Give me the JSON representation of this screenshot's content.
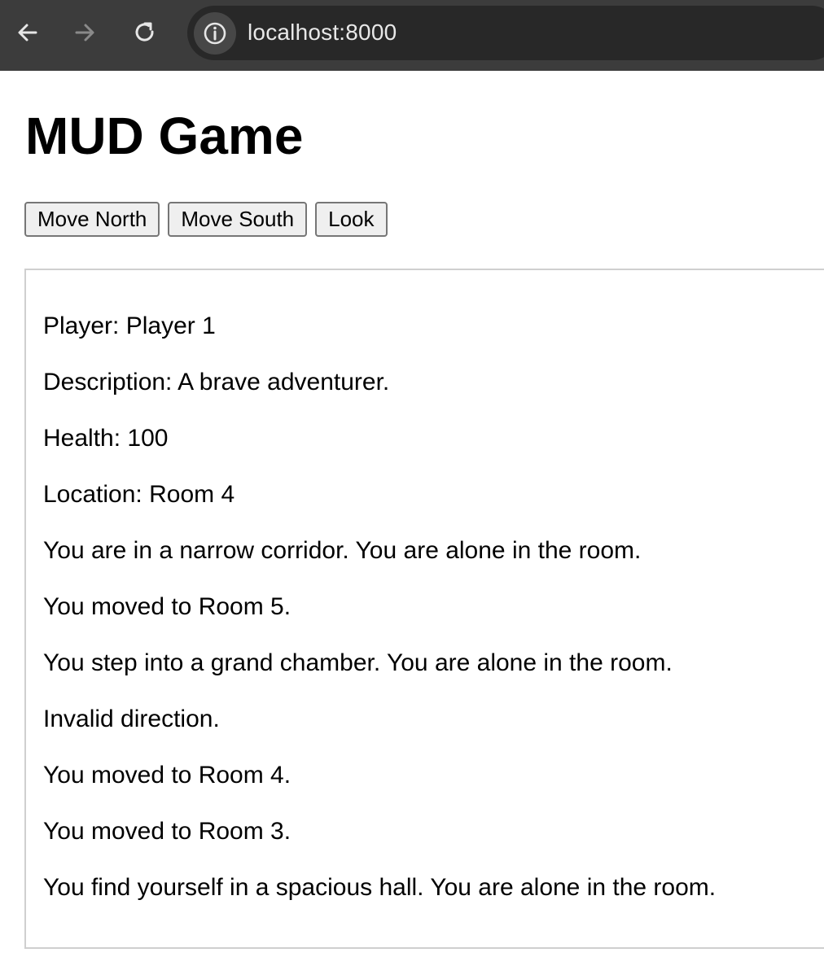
{
  "browser": {
    "url": "localhost:8000",
    "icons": {
      "back": "arrow-left-icon",
      "forward": "arrow-right-icon",
      "reload": "reload-icon",
      "site_info": "info-icon"
    }
  },
  "page": {
    "title": "MUD Game",
    "buttons": {
      "move_north": "Move North",
      "move_south": "Move South",
      "look": "Look"
    },
    "log": [
      "Player: Player 1",
      "Description: A brave adventurer.",
      "Health: 100",
      "Location: Room 4",
      "You are in a narrow corridor. You are alone in the room.",
      "You moved to Room 5.",
      "You step into a grand chamber. You are alone in the room.",
      "Invalid direction.",
      "You moved to Room 4.",
      "You moved to Room 3.",
      "You find yourself in a spacious hall. You are alone in the room."
    ]
  }
}
